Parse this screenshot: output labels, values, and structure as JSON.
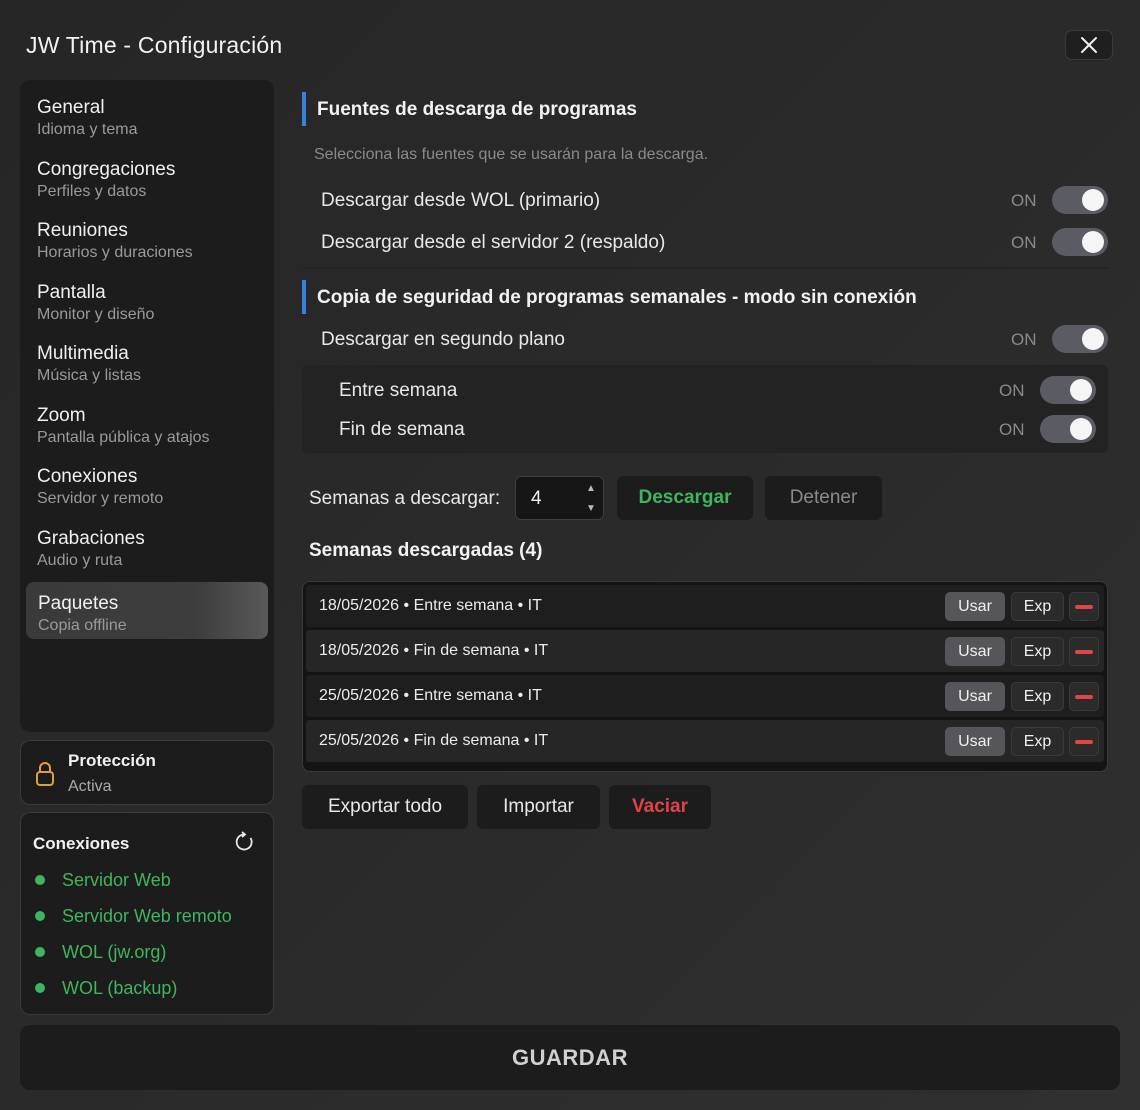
{
  "window": {
    "title": "JW Time - Configuración"
  },
  "sidebar": {
    "items": [
      {
        "label": "General",
        "sub": "Idioma y tema"
      },
      {
        "label": "Congregaciones",
        "sub": "Perfiles y datos"
      },
      {
        "label": "Reuniones",
        "sub": "Horarios y duraciones"
      },
      {
        "label": "Pantalla",
        "sub": "Monitor y diseño"
      },
      {
        "label": "Multimedia",
        "sub": "Música y listas"
      },
      {
        "label": "Zoom",
        "sub": "Pantalla pública y atajos"
      },
      {
        "label": "Conexiones",
        "sub": "Servidor y remoto"
      },
      {
        "label": "Grabaciones",
        "sub": "Audio y ruta"
      },
      {
        "label": "Paquetes",
        "sub": "Copia offline"
      }
    ],
    "active_index": 8
  },
  "protection": {
    "title": "Protección",
    "status": "Activa",
    "icon": "lock-icon"
  },
  "connections": {
    "title": "Conexiones",
    "items": [
      "Servidor Web",
      "Servidor Web remoto",
      "WOL (jw.org)",
      "WOL (backup)"
    ],
    "status_color": "#3fb55d"
  },
  "sources": {
    "title": "Fuentes de descarga de programas",
    "hint": "Selecciona las fuentes que se usarán para la descarga.",
    "wol_label": "Descargar desde WOL (primario)",
    "wol_state": "ON",
    "server2_label": "Descargar desde el servidor 2 (respaldo)",
    "server2_state": "ON"
  },
  "backup": {
    "title": "Copia de seguridad de programas semanales - modo sin conexión",
    "background_label": "Descargar en segundo plano",
    "background_state": "ON",
    "midweek_label": "Entre semana",
    "midweek_state": "ON",
    "weekend_label": "Fin de semana",
    "weekend_state": "ON",
    "weeks_label": "Semanas a descargar:",
    "weeks_value": "4",
    "download_label": "Descargar",
    "stop_label": "Detener"
  },
  "downloaded": {
    "title": "Semanas descargadas (4)",
    "rows": [
      "18/05/2026 • Entre semana • IT",
      "18/05/2026 • Fin de semana • IT",
      "25/05/2026 • Entre semana • IT",
      "25/05/2026 • Fin de semana • IT"
    ],
    "use_label": "Usar",
    "exp_label": "Exp",
    "export_all": "Exportar todo",
    "import": "Importar",
    "clear": "Vaciar"
  },
  "footer": {
    "save": "GUARDAR"
  },
  "colors": {
    "accent": "#3b82e0",
    "success": "#3fb55d",
    "danger": "#e04444"
  }
}
